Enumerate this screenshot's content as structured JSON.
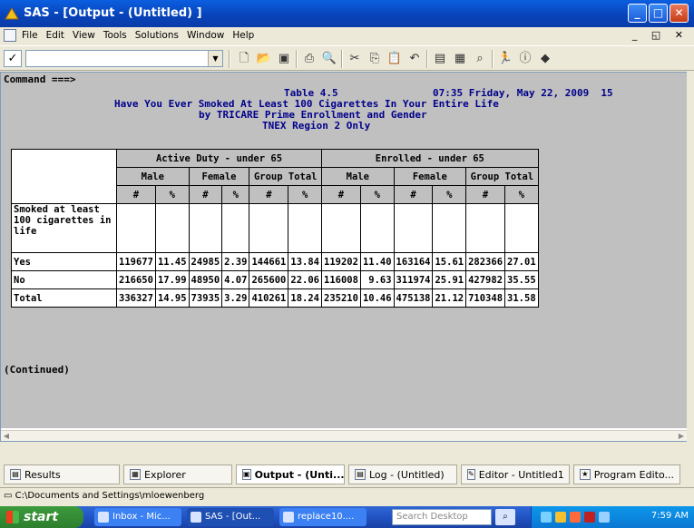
{
  "window": {
    "title": "SAS - [Output - (Untitled) ]"
  },
  "menu": [
    "File",
    "Edit",
    "View",
    "Tools",
    "Solutions",
    "Window",
    "Help"
  ],
  "toolbar": {
    "check_mark": "✓",
    "command_value": ""
  },
  "output": {
    "command_prompt": "Command ===>",
    "header": {
      "table_no": "Table 4.5",
      "datetime": "07:35 Friday, May 22, 2009  15",
      "line1": "Have You Ever Smoked At Least 100 Cigarettes In Your Entire Life",
      "line2": "by TRICARE Prime Enrollment and Gender",
      "line3": "TNEX Region 2 Only"
    },
    "table": {
      "groups": [
        "Active Duty - under 65",
        "Enrolled - under 65"
      ],
      "subgroups": [
        "Male",
        "Female",
        "Group Total",
        "Male",
        "Female",
        "Group Total"
      ],
      "stat_headers": [
        "#",
        "%",
        "#",
        "%",
        "#",
        "%",
        "#",
        "%",
        "#",
        "%",
        "#",
        "%"
      ],
      "row_title": "Smoked at least 100 cigarettes in life",
      "rows": [
        {
          "label": "Yes",
          "values": [
            "119677",
            "11.45",
            "24985",
            "2.39",
            "144661",
            "13.84",
            "119202",
            "11.40",
            "163164",
            "15.61",
            "282366",
            "27.01"
          ]
        },
        {
          "label": "No",
          "values": [
            "216650",
            "17.99",
            "48950",
            "4.07",
            "265600",
            "22.06",
            "116008",
            "9.63",
            "311974",
            "25.91",
            "427982",
            "35.55"
          ]
        },
        {
          "label": "Total",
          "values": [
            "336327",
            "14.95",
            "73935",
            "3.29",
            "410261",
            "18.24",
            "235210",
            "10.46",
            "475138",
            "21.12",
            "710348",
            "31.58"
          ]
        }
      ]
    },
    "continued": "(Continued)"
  },
  "window_tabs": [
    "Results",
    "Explorer",
    "Output - (Unti...",
    "Log - (Untitled)",
    "Editor - Untitled1",
    "Program Edito..."
  ],
  "status": {
    "path": "C:\\Documents and Settings\\mloewenberg"
  },
  "taskbar": {
    "start": "start",
    "items": [
      "Inbox - Mic...",
      "SAS - [Out...",
      "replace10...."
    ],
    "search_placeholder": "Search Desktop",
    "clock": "7:59 AM"
  }
}
